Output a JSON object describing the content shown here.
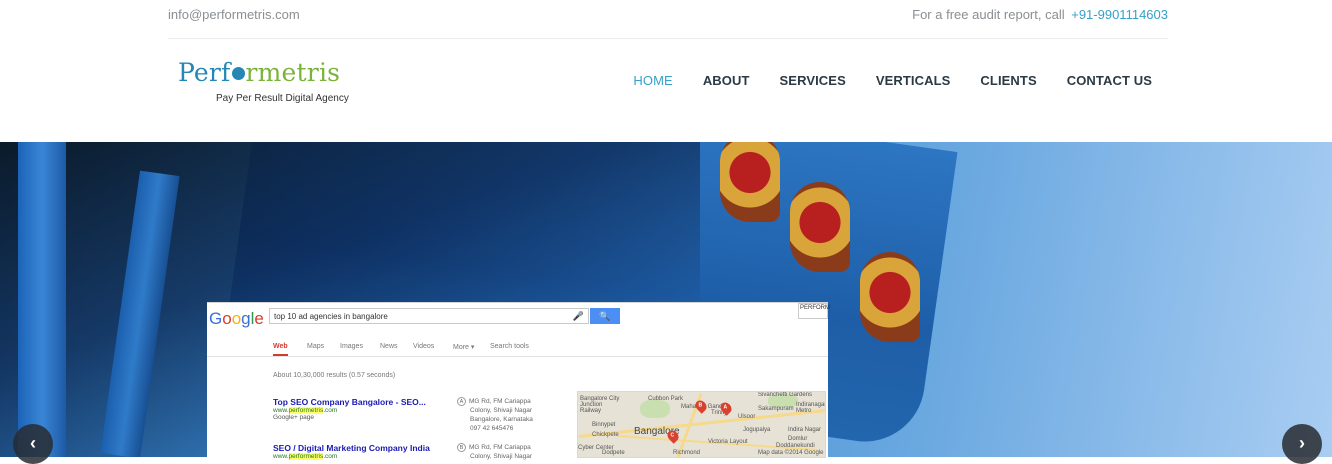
{
  "topbar": {
    "email": "info@performetris.com",
    "audit_text": "For a free audit report, call",
    "phone": "+91-9901114603"
  },
  "logo": {
    "part1": "Perf",
    "part2": "rmetris",
    "tagline": "Pay Per Result Digital Agency"
  },
  "nav": {
    "items": [
      "HOME",
      "ABOUT",
      "SERVICES",
      "VERTICALS",
      "CLIENTS",
      "CONTACT US"
    ],
    "active": "HOME"
  },
  "slide": {
    "google_letters": [
      "G",
      "o",
      "o",
      "g",
      "l",
      "e"
    ],
    "query": "top 10 ad agencies in bangalore",
    "search_icon": "magnifier-icon",
    "corner_text": "PERFORM",
    "tabs": [
      "Web",
      "Maps",
      "Images",
      "News",
      "Videos",
      "More ▾",
      "Search tools"
    ],
    "results_count": "About 10,30,000 results (0.57 seconds)",
    "results": [
      {
        "title": "Top SEO Company Bangalore - SEO...",
        "url_prefix": "www.",
        "url_hl": "performetris",
        "url_suffix": ".com",
        "sub": "Google+ page",
        "pin": "A",
        "address": [
          "MG Rd, FM Cariappa",
          "Colony, Shivaji Nagar",
          "Bangalore, Karnataka",
          "097 42 645476"
        ]
      },
      {
        "title": "SEO / Digital Marketing Company India",
        "url_prefix": "www.",
        "url_hl": "performetris",
        "url_suffix": ".com",
        "sub": "",
        "pin": "B",
        "address": [
          "MG Rd, FM Cariappa",
          "Colony, Shivaji Nagar"
        ]
      }
    ],
    "map": {
      "labels": [
        "Bangalore City Junction Railway",
        "Cubbon Park",
        "Mahatma Gandhi",
        "Ulsoor",
        "Indiranagar Metro",
        "Binnypet",
        "Chickpete",
        "Bangalore",
        "Jogupalya",
        "Indira Nagar",
        "Domlur",
        "Doddanekundi",
        "Victoria Layout",
        "Richmond",
        "Cyber Center",
        "Dodpete",
        "Map data ©2014 Google",
        "Sivanchetti Gardens",
        "Trinity",
        "Sakampuram"
      ],
      "markers": [
        "B",
        "A",
        "C"
      ]
    }
  },
  "carousel": {
    "prev": "‹",
    "next": "›"
  },
  "colors": {
    "accent": "#36a0c6",
    "logo_blue": "#2687b4",
    "logo_green": "#7bb33a",
    "nav_text": "#2b3a45"
  }
}
